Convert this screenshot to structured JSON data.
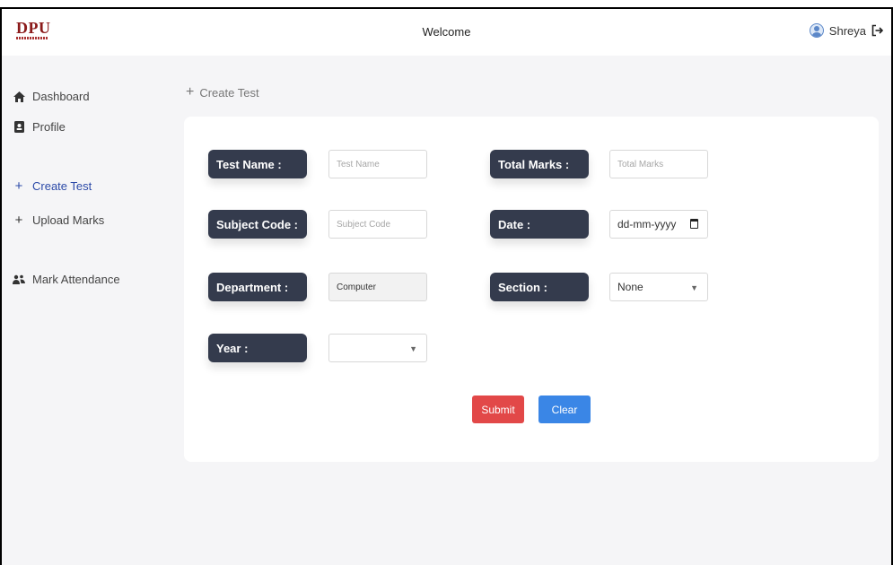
{
  "header": {
    "logo_text": "DPU",
    "title": "Welcome",
    "user_name": "Shreya",
    "user_icon": "user-avatar-icon",
    "logout_icon": "logout-icon"
  },
  "sidebar": {
    "items": [
      {
        "label": "Dashboard",
        "icon": "home-icon"
      },
      {
        "label": "Profile",
        "icon": "id-badge-icon"
      },
      {
        "label": "Create Test",
        "icon": "plus-icon",
        "active": true
      },
      {
        "label": "Upload Marks",
        "icon": "plus-icon"
      },
      {
        "label": "Mark Attendance",
        "icon": "people-icon"
      }
    ]
  },
  "breadcrumb": {
    "label": "Create Test",
    "icon": "plus-icon"
  },
  "form": {
    "test_name": {
      "label": "Test Name :",
      "placeholder": "Test Name",
      "value": ""
    },
    "total_marks": {
      "label": "Total Marks :",
      "placeholder": "Total Marks",
      "value": ""
    },
    "subject_code": {
      "label": "Subject Code :",
      "placeholder": "Subject Code",
      "value": ""
    },
    "date": {
      "label": "Date :",
      "value": "dd-mm-yyyy"
    },
    "department": {
      "label": "Department :",
      "value": "Computer"
    },
    "section": {
      "label": "Section :",
      "value": "None"
    },
    "year": {
      "label": "Year :",
      "value": ""
    }
  },
  "buttons": {
    "submit": "Submit",
    "clear": "Clear"
  },
  "colors": {
    "label_bg": "#343b4d",
    "submit": "#e24848",
    "clear": "#3a86e6",
    "active_nav": "#2c4aa8",
    "logo": "#8b1a1a"
  }
}
